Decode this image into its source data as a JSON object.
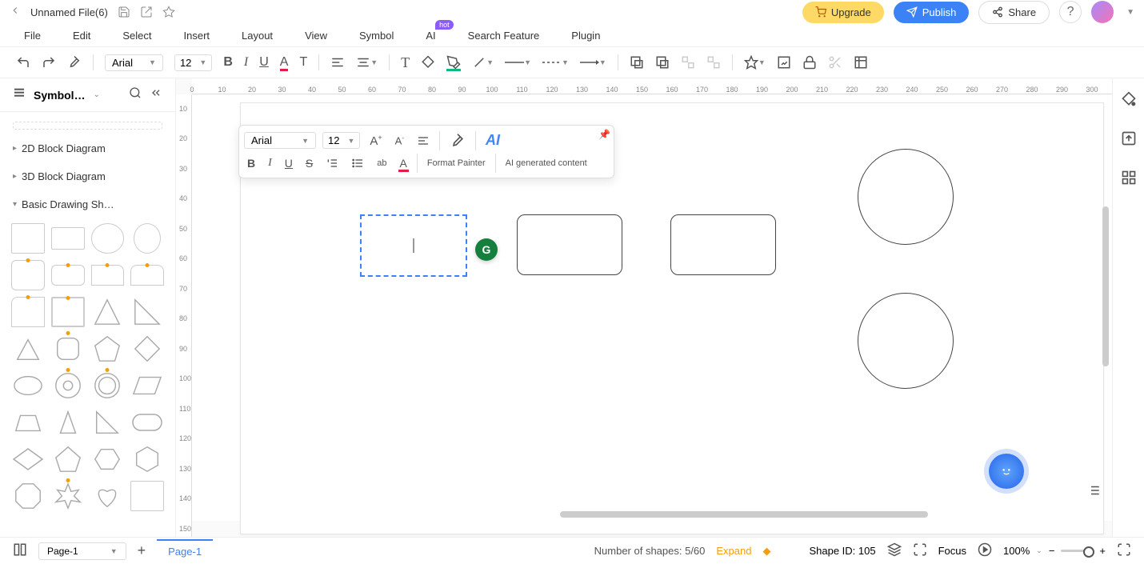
{
  "titleBar": {
    "filename": "Unnamed File(6)",
    "upgrade": "Upgrade",
    "publish": "Publish",
    "share": "Share"
  },
  "menu": {
    "file": "File",
    "edit": "Edit",
    "select": "Select",
    "insert": "Insert",
    "layout": "Layout",
    "view": "View",
    "symbol": "Symbol",
    "ai": "AI",
    "aiHot": "hot",
    "search": "Search Feature",
    "plugin": "Plugin"
  },
  "toolbar": {
    "font": "Arial",
    "fontSize": "12"
  },
  "sidebar": {
    "title": "Symbol…",
    "sections": {
      "block2d": "2D Block Diagram",
      "block3d": "3D Block Diagram",
      "basic": "Basic Drawing Sh…"
    }
  },
  "floatToolbar": {
    "font": "Arial",
    "fontSize": "12",
    "formatPainter": "Format Painter",
    "aiGenerated": "AI generated content"
  },
  "rulerH": [
    "0",
    "10",
    "20",
    "30",
    "40",
    "50",
    "60",
    "70",
    "80",
    "90",
    "100",
    "110",
    "120",
    "130",
    "140",
    "150",
    "160",
    "170",
    "180",
    "190",
    "200",
    "210",
    "220",
    "230",
    "240",
    "250",
    "260",
    "270",
    "280",
    "290",
    "300"
  ],
  "rulerV": [
    "10",
    "20",
    "30",
    "40",
    "50",
    "60",
    "70",
    "80",
    "90",
    "100",
    "110",
    "120",
    "130",
    "140",
    "150"
  ],
  "statusBar": {
    "pageSelect": "Page-1",
    "pageTab": "Page-1",
    "shapesCount": "Number of shapes: 5/60",
    "expand": "Expand",
    "shapeId": "Shape ID: 105",
    "focus": "Focus",
    "zoom": "100%"
  }
}
